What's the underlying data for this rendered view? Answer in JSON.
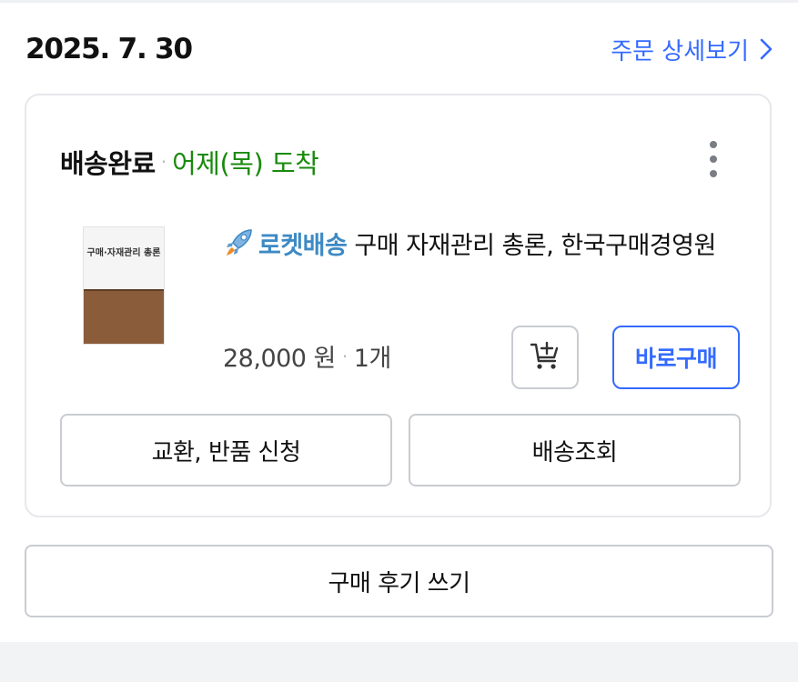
{
  "order": {
    "date": "2025. 7. 30",
    "detail_link": "주문 상세보기"
  },
  "shipment": {
    "status": "배송완료",
    "separator": "·",
    "arrival": "어제(목) 도착"
  },
  "product": {
    "delivery_badge": "로켓배송",
    "title": "구매 자재관리 총론, 한국구매경영원",
    "price": "28,000 원",
    "separator": "·",
    "quantity": "1개",
    "thumbnail_title": "구매·자재관리 총론"
  },
  "buttons": {
    "buy_now": "바로구매",
    "exchange_return": "교환, 반품 신청",
    "track_delivery": "배송조회",
    "write_review": "구매 후기 쓰기"
  },
  "icons": {
    "detail_chevron": "chevron-right-icon",
    "more": "kebab-menu-icon",
    "rocket": "rocket-icon",
    "cart": "add-to-cart-icon"
  },
  "colors": {
    "link_blue": "#346aff",
    "arrival_green": "#198a0d",
    "rocket_blue": "#3d8ac5"
  }
}
